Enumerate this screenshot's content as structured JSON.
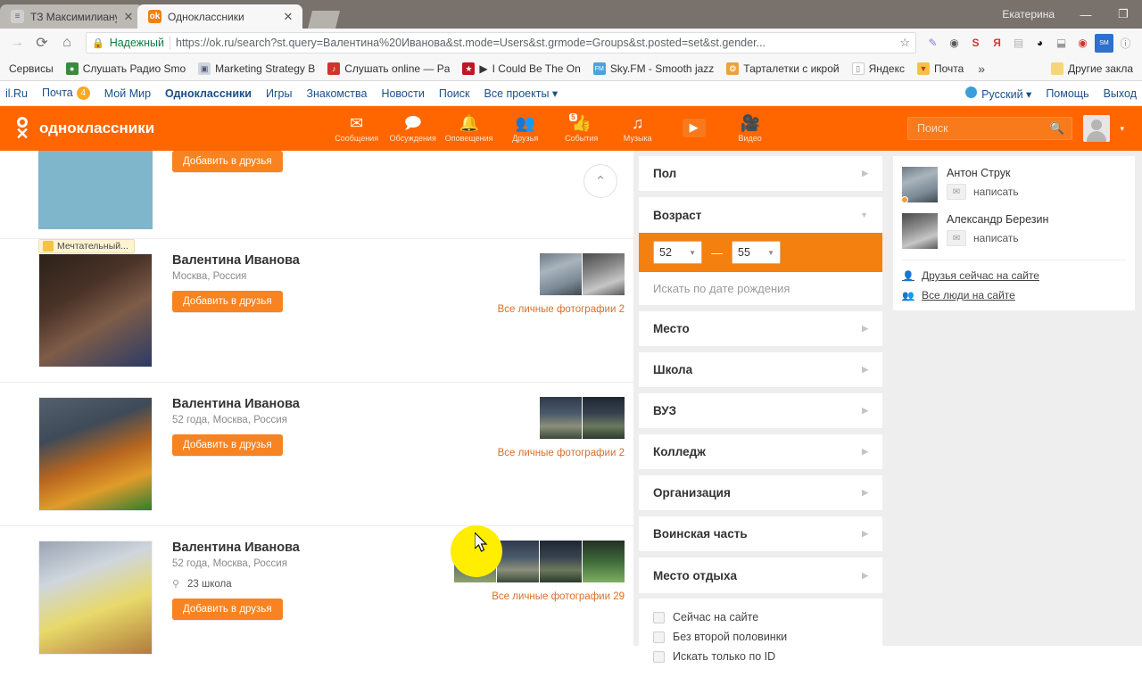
{
  "browser": {
    "tabs": [
      {
        "title": "ТЗ Максимилиану - Goo",
        "close": "✕",
        "favicon_name": "doc-favicon"
      },
      {
        "title": "Одноклассники",
        "close": "✕",
        "favicon_name": "ok-favicon",
        "favicon_letter": "ok"
      }
    ],
    "window_user": "Екатерина",
    "minimize": "—",
    "maximize": "❐",
    "nav": {
      "back": "→",
      "reload": "⟳",
      "home": "⌂"
    },
    "omnibox": {
      "secure_label": "Надежный",
      "url_full": "https://ok.ru/search?st.query=Валентина%20Иванова&st.mode=Users&st.grmode=Groups&st.posted=set&st.gender...",
      "url_scheme": "https://",
      "url_host": "ok.ru",
      "url_rest": "/search?st.query=Валентина%20Иванова&st.mode=Users&st.grmode=Groups&st.posted=set&st.gender...",
      "star": "☆"
    },
    "extensions": [
      {
        "name": "pen-extension-icon",
        "glyph": "✎",
        "color": "#8f7bd4"
      },
      {
        "name": "camera-extension-icon",
        "glyph": "◉",
        "color": "#5a5a5a"
      },
      {
        "name": "savefrom-extension-icon",
        "glyph": "S",
        "color": "#d0342c"
      },
      {
        "name": "yandex-extension-icon",
        "glyph": "Я",
        "color": "#e3342f"
      },
      {
        "name": "pdf-extension-icon",
        "glyph": "▤",
        "color": "#b0b0b0"
      },
      {
        "name": "opera-extension-icon",
        "glyph": "◕",
        "color": "#111111"
      },
      {
        "name": "screenshot-extension-icon",
        "glyph": "⬓",
        "color": "#9a9a9a"
      },
      {
        "name": "location-extension-icon",
        "glyph": "◉",
        "color": "#d0342c"
      },
      {
        "name": "sm-extension-icon",
        "glyph": "SM",
        "color": "#2f6fd0"
      },
      {
        "name": "info-extension-icon",
        "glyph": "i",
        "color": "#8a8a8a"
      }
    ],
    "bookmarks": [
      {
        "label": "Сервисы",
        "icon_name": "services-bookmark-icon",
        "color": "transparent"
      },
      {
        "label": "Слушать Радио Smo",
        "icon_name": "radio-bookmark-icon",
        "color": "#3a8c3a"
      },
      {
        "label": "Marketing Strategy B",
        "icon_name": "marketing-bookmark-icon",
        "color": "#cfd6dd"
      },
      {
        "label": "Слушать online — Pa",
        "icon_name": "online-bookmark-icon",
        "color": "#d0342c"
      },
      {
        "label": "I Could Be The On",
        "icon_name": "video-bookmark-icon",
        "color": "#c01722"
      },
      {
        "label": "Sky.FM - Smooth jazz",
        "icon_name": "skyfm-bookmark-icon",
        "color": "#4aa3df"
      },
      {
        "label": "Тарталетки с икрой",
        "icon_name": "recipe-bookmark-icon",
        "color": "#e8a33d"
      },
      {
        "label": "Яндекс",
        "icon_name": "yandex-bookmark-icon",
        "color": "#ffffff"
      },
      {
        "label": "Почта",
        "icon_name": "mail-bookmark-icon",
        "color": "#f5c243"
      }
    ],
    "bookmarks_overflow": "»",
    "other_bookmarks": {
      "label": "Другие закла",
      "icon_name": "folder-icon"
    }
  },
  "mailru_bar": {
    "left_items": [
      {
        "label": "il.Ru",
        "active": false
      },
      {
        "label": "Почта",
        "active": false,
        "count": "4"
      },
      {
        "label": "Мой Мир",
        "active": false
      },
      {
        "label": "Одноклассники",
        "active": true
      },
      {
        "label": "Игры",
        "active": false
      },
      {
        "label": "Знакомства",
        "active": false
      },
      {
        "label": "Новости",
        "active": false
      },
      {
        "label": "Поиск",
        "active": false
      },
      {
        "label": "Все проекты ▾",
        "active": false
      }
    ],
    "right_items": [
      {
        "label": "Русский ▾",
        "icon_name": "globe-icon"
      },
      {
        "label": "Помощь"
      },
      {
        "label": "Выход"
      }
    ]
  },
  "ok_header": {
    "logo_text": "одноклассники",
    "nav": [
      {
        "label": "Сообщения",
        "icon_name": "envelope-icon",
        "glyph": "✉"
      },
      {
        "label": "Обсуждения",
        "icon_name": "chat-bubbles-icon",
        "glyph": "💬"
      },
      {
        "label": "Оповещения",
        "icon_name": "bell-icon",
        "glyph": "🔔"
      },
      {
        "label": "Друзья",
        "icon_name": "people-icon",
        "glyph": "👥"
      },
      {
        "label": "События",
        "icon_name": "thumbs-up-icon",
        "glyph": "👍",
        "badge": "5"
      },
      {
        "label": "Музыка",
        "icon_name": "music-note-icon",
        "glyph": "♫"
      },
      {
        "label": "",
        "icon_name": "play-button-icon",
        "glyph": "▶"
      },
      {
        "label": "Видео",
        "icon_name": "video-camera-icon",
        "glyph": "📹"
      }
    ],
    "search_placeholder": "Поиск",
    "search_value": "",
    "avatar_caret": "▾"
  },
  "results": {
    "scroll_top_glyph": "⌃",
    "partial_top": {
      "add_friend_label": "Добавить в друзья"
    },
    "items": [
      {
        "mood": "Мечтательный...",
        "name": "Валентина Иванова",
        "meta": "Москва, Россия",
        "school": "",
        "add_friend_label": "Добавить в друзья",
        "photos_link": "Все личные фотографии 2",
        "photo_count": 2,
        "avatar_class": "pic2",
        "photo_classes": [
          "pic9",
          "pic10"
        ]
      },
      {
        "mood": "",
        "name": "Валентина Иванова",
        "meta": "52 года, Москва, Россия",
        "school": "",
        "add_friend_label": "Добавить в друзья",
        "photos_link": "Все личные фотографии 2",
        "photo_count": 2,
        "avatar_class": "pic3",
        "photo_classes": [
          "pic5",
          "pic6"
        ]
      },
      {
        "mood": "",
        "name": "Валентина Иванова",
        "meta": "52 года, Москва, Россия",
        "school": "23 школа",
        "add_friend_label": "Добавить в друзья",
        "photos_link": "Все личные фотографии 29",
        "photo_count": 29,
        "avatar_class": "pic4",
        "photo_classes": [
          "pic7",
          "pic5",
          "pic6",
          "pic8"
        ]
      }
    ]
  },
  "filters": {
    "rows": [
      {
        "label": "Пол",
        "arrow": "▶",
        "expanded": false
      },
      {
        "label": "Возраст",
        "arrow": "▼",
        "expanded": true
      }
    ],
    "age": {
      "from": "52",
      "to": "55",
      "dash": "—",
      "caret": "▼"
    },
    "birthdate_placeholder": "Искать по дате рождения",
    "rows2": [
      {
        "label": "Место",
        "arrow": "▶"
      },
      {
        "label": "Школа",
        "arrow": "▶"
      },
      {
        "label": "ВУЗ",
        "arrow": "▶"
      },
      {
        "label": "Колледж",
        "arrow": "▶"
      },
      {
        "label": "Организация",
        "arrow": "▶"
      },
      {
        "label": "Воинская часть",
        "arrow": "▶"
      },
      {
        "label": "Место отдыха",
        "arrow": "▶"
      }
    ],
    "checkboxes": [
      {
        "label": "Сейчас на сайте",
        "checked": false
      },
      {
        "label": "Без второй половинки",
        "checked": false
      },
      {
        "label": "Искать только по ID",
        "checked": false
      }
    ]
  },
  "right_panel": {
    "people": [
      {
        "name": "Антон Струк",
        "action": "написать",
        "online": true,
        "avatar_class": "pic9"
      },
      {
        "name": "Александр Березин",
        "action": "написать",
        "online": false,
        "avatar_class": "pic10"
      }
    ],
    "links": [
      {
        "label": "Друзья сейчас на сайте",
        "icon_name": "friends-online-icon",
        "glyph": "👤"
      },
      {
        "label": "Все люди на сайте",
        "icon_name": "all-people-icon",
        "glyph": "👥"
      }
    ]
  },
  "colors": {
    "brand_orange": "#ff6600",
    "button_orange": "#f78321",
    "age_bar_orange": "#f3800f",
    "link_orange": "#d96f2a",
    "cursor_highlight": "#ffee00"
  }
}
